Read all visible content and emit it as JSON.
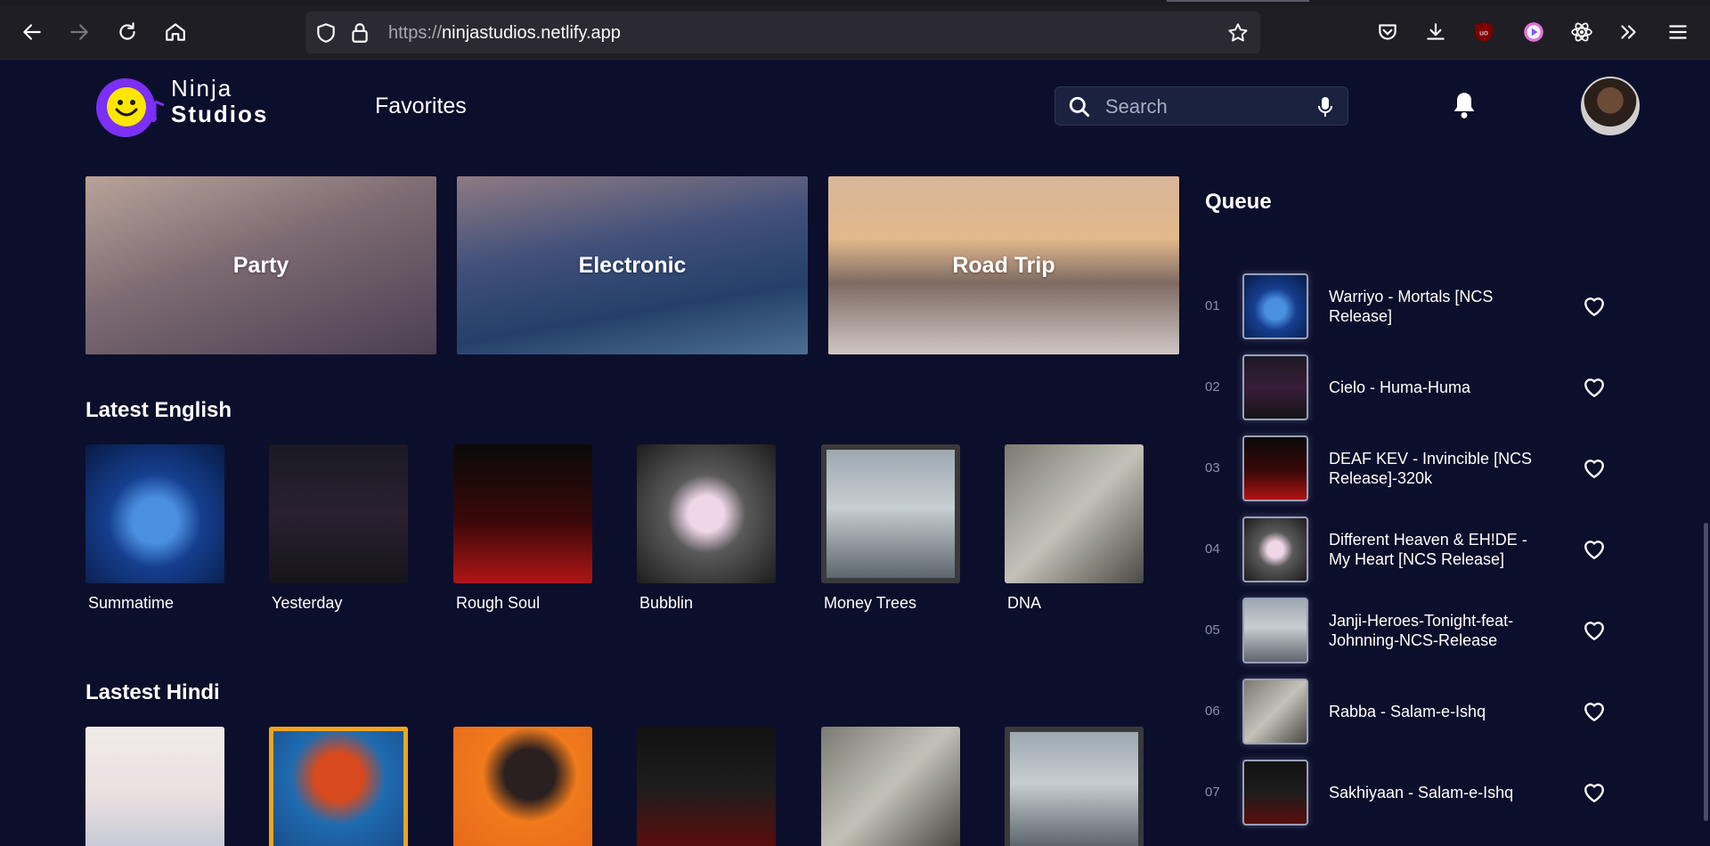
{
  "browser": {
    "url_protocol": "https://",
    "url_host": "ninjastudios.netlify.app"
  },
  "header": {
    "logo_line1": "Ninja",
    "logo_line2": "Studios",
    "nav_favorites": "Favorites",
    "search_placeholder": "Search"
  },
  "categories": [
    "Party",
    "Electronic",
    "Road Trip"
  ],
  "sections": {
    "latest_english": {
      "heading": "Latest English",
      "songs": [
        "Summatime",
        "Yesterday",
        "Rough Soul",
        "Bubblin",
        "Money Trees",
        "DNA"
      ]
    },
    "latest_hindi": {
      "heading": "Lastest Hindi"
    }
  },
  "queue": {
    "title": "Queue",
    "items": [
      {
        "num": "01",
        "title": "Warriyo - Mortals [NCS Release]"
      },
      {
        "num": "02",
        "title": "Cielo - Huma-Huma"
      },
      {
        "num": "03",
        "title": "DEAF KEV - Invincible [NCS Release]-320k"
      },
      {
        "num": "04",
        "title": "Different Heaven & EH!DE - My Heart [NCS Release]"
      },
      {
        "num": "05",
        "title": "Janji-Heroes-Tonight-feat-Johnning-NCS-Release"
      },
      {
        "num": "06",
        "title": "Rabba - Salam-e-Ishq"
      },
      {
        "num": "07",
        "title": "Sakhiyaan - Salam-e-Ishq"
      }
    ]
  },
  "colors": {
    "page_bg": "#0c0f2b",
    "accent_purple": "#7b2ff7",
    "logo_yellow": "#ffe600"
  }
}
